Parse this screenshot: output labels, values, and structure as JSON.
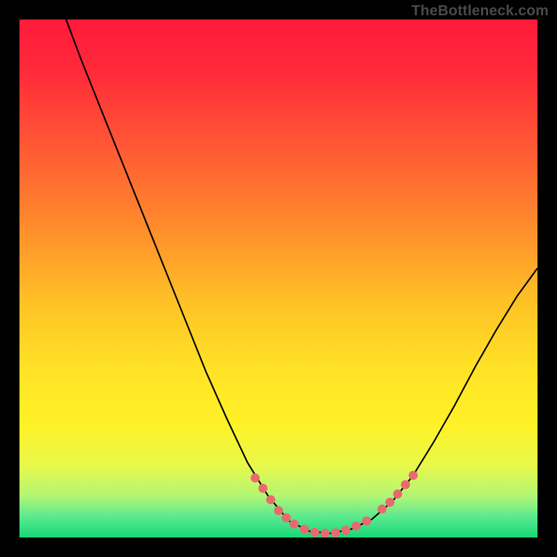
{
  "watermark": "TheBottleneck.com",
  "chart_data": {
    "type": "line",
    "title": "",
    "xlabel": "",
    "ylabel": "",
    "xlim": [
      0,
      100
    ],
    "ylim": [
      0,
      100
    ],
    "gradient_stops": [
      {
        "offset": 0.0,
        "color": "#ff1a3a"
      },
      {
        "offset": 0.1,
        "color": "#ff2a3a"
      },
      {
        "offset": 0.25,
        "color": "#ff5a34"
      },
      {
        "offset": 0.4,
        "color": "#ff8c2c"
      },
      {
        "offset": 0.55,
        "color": "#ffc326"
      },
      {
        "offset": 0.68,
        "color": "#ffe326"
      },
      {
        "offset": 0.78,
        "color": "#fff126"
      },
      {
        "offset": 0.86,
        "color": "#e9f84a"
      },
      {
        "offset": 0.92,
        "color": "#b2f675"
      },
      {
        "offset": 0.96,
        "color": "#5be98f"
      },
      {
        "offset": 1.0,
        "color": "#15d877"
      }
    ],
    "curve": [
      {
        "x": 9.0,
        "y": 100.0
      },
      {
        "x": 12.0,
        "y": 92.0
      },
      {
        "x": 16.0,
        "y": 82.0
      },
      {
        "x": 20.0,
        "y": 72.0
      },
      {
        "x": 24.0,
        "y": 62.0
      },
      {
        "x": 28.0,
        "y": 52.0
      },
      {
        "x": 32.0,
        "y": 42.0
      },
      {
        "x": 36.0,
        "y": 32.0
      },
      {
        "x": 40.0,
        "y": 23.0
      },
      {
        "x": 44.0,
        "y": 14.5
      },
      {
        "x": 48.0,
        "y": 8.0
      },
      {
        "x": 52.0,
        "y": 3.2
      },
      {
        "x": 56.0,
        "y": 1.2
      },
      {
        "x": 60.0,
        "y": 0.8
      },
      {
        "x": 64.0,
        "y": 1.6
      },
      {
        "x": 68.0,
        "y": 3.5
      },
      {
        "x": 72.0,
        "y": 7.0
      },
      {
        "x": 76.0,
        "y": 12.0
      },
      {
        "x": 80.0,
        "y": 18.5
      },
      {
        "x": 84.0,
        "y": 25.5
      },
      {
        "x": 88.0,
        "y": 33.0
      },
      {
        "x": 92.0,
        "y": 40.0
      },
      {
        "x": 96.0,
        "y": 46.5
      },
      {
        "x": 100.0,
        "y": 52.0
      }
    ],
    "markers": [
      {
        "x": 45.5,
        "y": 11.5
      },
      {
        "x": 47.0,
        "y": 9.5
      },
      {
        "x": 48.5,
        "y": 7.3
      },
      {
        "x": 50.0,
        "y": 5.2
      },
      {
        "x": 51.5,
        "y": 3.8
      },
      {
        "x": 53.0,
        "y": 2.6
      },
      {
        "x": 55.0,
        "y": 1.6
      },
      {
        "x": 57.0,
        "y": 1.0
      },
      {
        "x": 59.0,
        "y": 0.8
      },
      {
        "x": 61.0,
        "y": 0.9
      },
      {
        "x": 63.0,
        "y": 1.4
      },
      {
        "x": 65.0,
        "y": 2.2
      },
      {
        "x": 67.0,
        "y": 3.2
      },
      {
        "x": 70.0,
        "y": 5.5
      },
      {
        "x": 71.5,
        "y": 6.8
      },
      {
        "x": 73.0,
        "y": 8.4
      },
      {
        "x": 74.5,
        "y": 10.2
      },
      {
        "x": 76.0,
        "y": 12.0
      }
    ],
    "marker_color": "#e86a6f",
    "curve_color": "#000000"
  }
}
